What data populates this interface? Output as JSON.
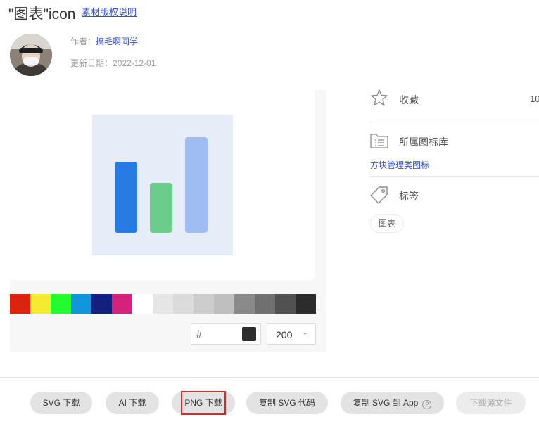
{
  "header": {
    "title": "\"图表\"icon",
    "license_link": "素材版权说明"
  },
  "author": {
    "label": "作者：",
    "name": "搞毛啊同学",
    "date_label": "更新日期：",
    "date": "2022-12-01"
  },
  "preview": {
    "icon_name": "bar-chart-icon",
    "bar_colors": [
      "#277be3",
      "#6ccc8c",
      "#9fbcf3"
    ],
    "bar_levels": [
      0.6,
      0.42,
      0.81
    ],
    "background": "#e7edf8"
  },
  "palette": {
    "colors": [
      "#dc2310",
      "#f4ea2f",
      "#23fb2f",
      "#1296db",
      "#12207f",
      "#d4237a",
      "#ffffff",
      "#e6e6e6",
      "#dbdbdb",
      "#cdcdcd",
      "#bfbfbf",
      "#8a8a8a",
      "#707070",
      "#515151",
      "#2c2c2c"
    ]
  },
  "color_input": {
    "prefix": "#",
    "value": "",
    "chip_color": "#2e2e2e"
  },
  "size_select": {
    "value": "200"
  },
  "sidebar": {
    "favorite_label": "收藏",
    "favorite_count": "10",
    "library_label": "所属图标库",
    "library_link": "方块管理类图标",
    "tags_label": "标签",
    "tags": [
      "图表"
    ]
  },
  "actions": {
    "svg_download": "SVG 下载",
    "ai_download": "AI 下载",
    "png_download": "PNG 下载",
    "copy_svg_code": "复制 SVG 代码",
    "copy_svg_to_app": "复制 SVG 到 App",
    "help_mark": "?",
    "download_source": "下载源文件"
  }
}
